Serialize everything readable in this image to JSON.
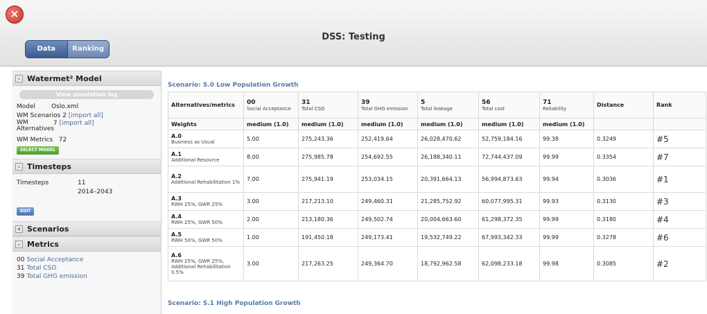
{
  "window": {
    "title": "DSS: Testing",
    "tabs": [
      {
        "label": "Data",
        "selected": true
      },
      {
        "label": "Ranking",
        "selected": false
      }
    ]
  },
  "sidebar": {
    "model": {
      "heading": "Watermet² Model",
      "view_log_label": "View simulation log",
      "model_label": "Model",
      "model_value": "Oslo.xml",
      "scenarios_label": "WM Scenarios",
      "scenarios_count": "2",
      "scenarios_link": "[import all]",
      "alternatives_label": "WM Alternatives",
      "alternatives_count": "7",
      "alternatives_link": "[import all]",
      "metrics_label": "WM Metrics",
      "metrics_count": "72",
      "select_model_label": "SELECT MODEL"
    },
    "timesteps": {
      "heading": "Timesteps",
      "label": "Timesteps",
      "count": "11",
      "range": "2014–2043",
      "edit_label": "EDIT"
    },
    "scenarios": {
      "heading": "Scenarios"
    },
    "metrics": {
      "heading": "Metrics",
      "items": [
        {
          "code": "00",
          "name": "Social Acceptance"
        },
        {
          "code": "31",
          "name": "Total CSO"
        },
        {
          "code": "39",
          "name": "Total GHG emission"
        }
      ]
    }
  },
  "main": {
    "scenario_title": "Scenario: S.0 Low Population Growth",
    "next_scenario_title": "Scenario: S.1 High Population Growth",
    "table": {
      "corner_label": "Alternatives/metrics",
      "weights_label": "Weights",
      "distance_label": "Distance",
      "rank_label": "Rank",
      "metrics": [
        {
          "code": "00",
          "name": "Social Acceptance",
          "weight": "medium (1.0)"
        },
        {
          "code": "31",
          "name": "Total CSO",
          "weight": "medium (1.0)"
        },
        {
          "code": "39",
          "name": "Total GHG emission",
          "weight": "medium (1.0)"
        },
        {
          "code": "5",
          "name": "Total leakage",
          "weight": "medium (1.0)"
        },
        {
          "code": "56",
          "name": "Total cost",
          "weight": "medium (1.0)"
        },
        {
          "code": "71",
          "name": "Reliability",
          "weight": "medium (1.0)"
        }
      ],
      "rows": [
        {
          "code": "A.0",
          "name": "Business as Usual",
          "values": [
            "5.00",
            "275,243.36",
            "252,419.64",
            "26,028,470.62",
            "52,759,184.16",
            "99.38"
          ],
          "distance": "0.3249",
          "rank": "#5"
        },
        {
          "code": "A.1",
          "name": "Additional Resource",
          "values": [
            "8.00",
            "275,985.78",
            "254,692.55",
            "26,188,340.11",
            "72,744,437.09",
            "99.99"
          ],
          "distance": "0.3354",
          "rank": "#7"
        },
        {
          "code": "A.2",
          "name": "Additional Rehabilitation 1%",
          "values": [
            "7.00",
            "275,941.19",
            "253,034.15",
            "20,391,664.13",
            "56,994,873.63",
            "99.94"
          ],
          "distance": "0.3036",
          "rank": "#1"
        },
        {
          "code": "A.3",
          "name": "RWH 25%, GWR 25%",
          "values": [
            "3.00",
            "217,213.10",
            "249,460.31",
            "21,285,752.92",
            "60,077,995.31",
            "99.93"
          ],
          "distance": "0.3130",
          "rank": "#3"
        },
        {
          "code": "A.4",
          "name": "RWH 25%, GWR 50%",
          "values": [
            "2.00",
            "213,180.36",
            "249,502.74",
            "20,004,663.60",
            "61,298,372.35",
            "99.99"
          ],
          "distance": "0.3180",
          "rank": "#4"
        },
        {
          "code": "A.5",
          "name": "RWH 50%, GWR 50%",
          "values": [
            "1.00",
            "191,450.18",
            "249,173.41",
            "19,532,749.22",
            "67,993,342.33",
            "99.99"
          ],
          "distance": "0.3278",
          "rank": "#6"
        },
        {
          "code": "A.6",
          "name": "RWH 25%, GWR 25%, Additional Rehabilitation 0.5%",
          "values": [
            "3.00",
            "217,263.25",
            "249,364.70",
            "18,792,962.58",
            "62,098,233.18",
            "99.98"
          ],
          "distance": "0.3085",
          "rank": "#2"
        }
      ]
    }
  }
}
